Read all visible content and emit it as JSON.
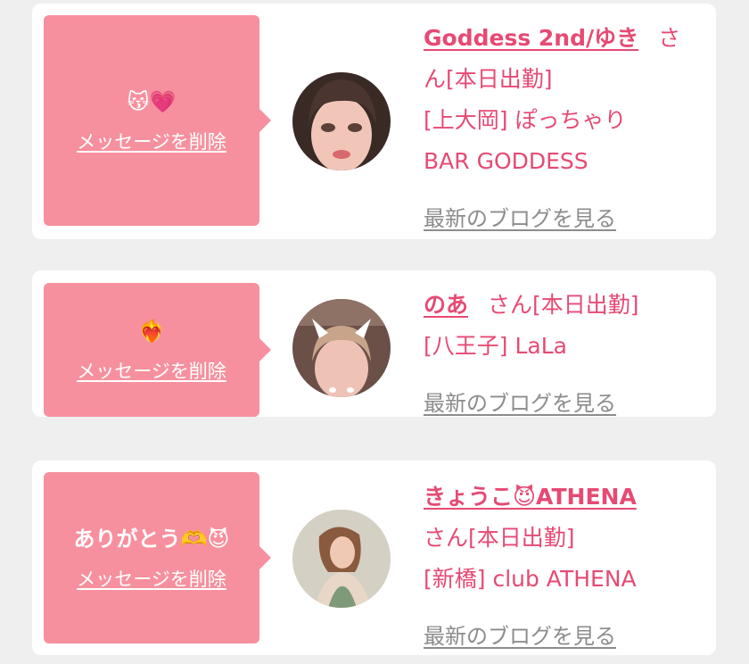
{
  "delete_label": "メッセージを削除",
  "blog_label": "最新のブログを見る",
  "suffix": "さん",
  "colors": {
    "accent_text": "#e64a73",
    "bubble": "#f7909e",
    "link_gray": "#8c8c8c",
    "background": "#efefef"
  },
  "messages": [
    {
      "message": "😽💗",
      "name": "Goddess 2nd/ゆき",
      "name_suffix_first": "さ",
      "name_suffix_rest": "ん[本日出勤]",
      "area_genre": "[上大岡] ぽっちゃり",
      "shop": "BAR GODDESS"
    },
    {
      "message": "❤️‍🔥",
      "name": "のあ",
      "status": "さん[本日出勤]",
      "area_shop": "[八王子] LaLa"
    },
    {
      "message": "ありがとう🫶😈",
      "name": "きょうこ😈ATHENA",
      "status": "さん[本日出勤]",
      "area_shop": "[新橋] club ATHENA"
    }
  ]
}
